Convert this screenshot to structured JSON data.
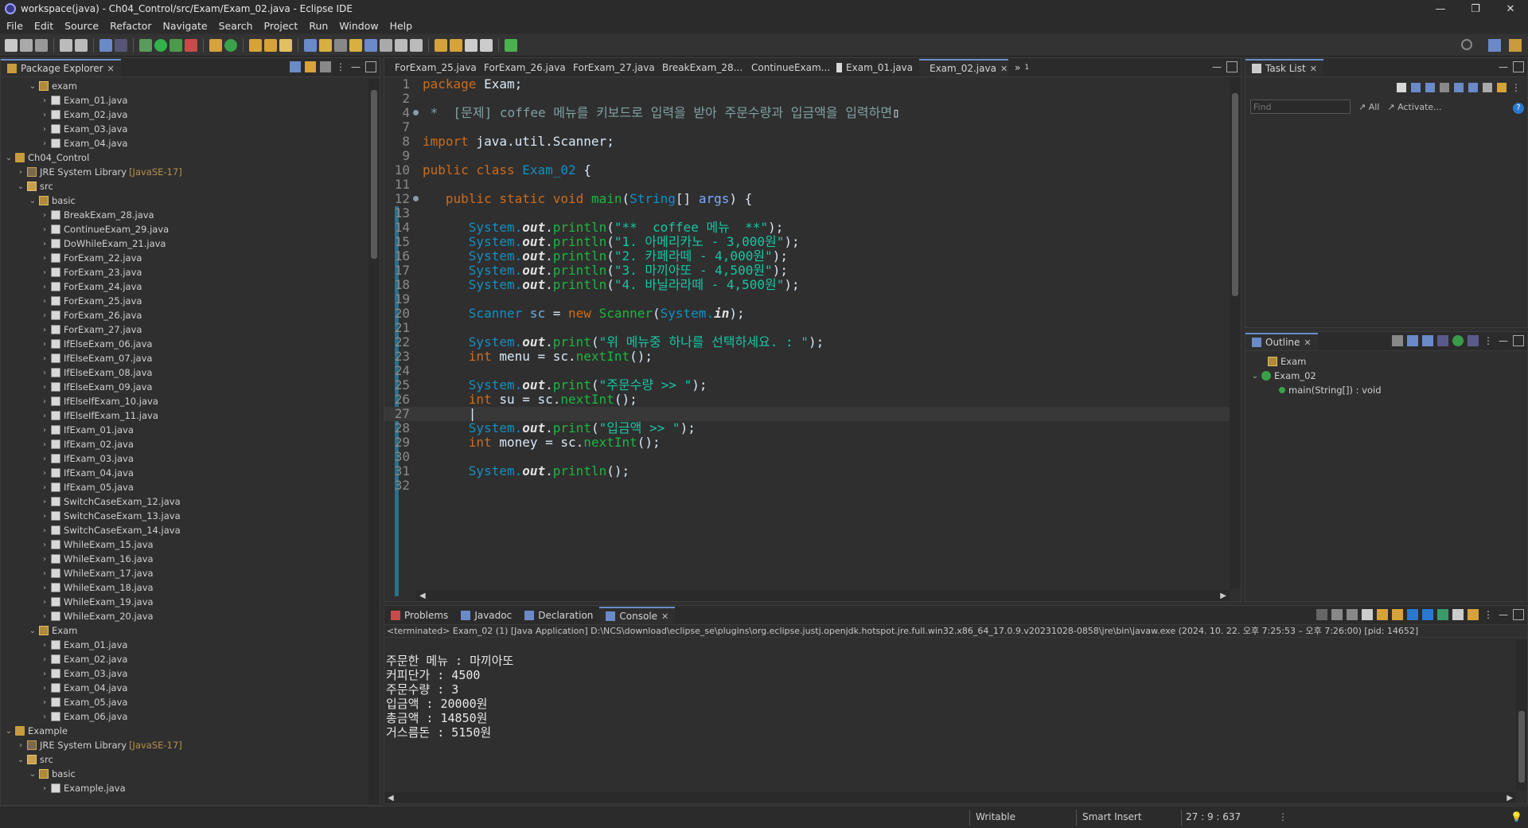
{
  "window": {
    "title": "workspace(java) - Ch04_Control/src/Exam/Exam_02.java - Eclipse IDE",
    "minimize": "—",
    "maximize": "❐",
    "close": "✕"
  },
  "menu": [
    "File",
    "Edit",
    "Source",
    "Refactor",
    "Navigate",
    "Search",
    "Project",
    "Run",
    "Window",
    "Help"
  ],
  "package_explorer": {
    "title": "Package Explorer",
    "rows": [
      {
        "indent": 2,
        "arrow": "⌄",
        "icon": "pkg",
        "label": "exam"
      },
      {
        "indent": 3,
        "arrow": "›",
        "icon": "file",
        "label": "Exam_01.java"
      },
      {
        "indent": 3,
        "arrow": "›",
        "icon": "file",
        "label": "Exam_02.java"
      },
      {
        "indent": 3,
        "arrow": "›",
        "icon": "file",
        "label": "Exam_03.java"
      },
      {
        "indent": 3,
        "arrow": "›",
        "icon": "file",
        "label": "Exam_04.java"
      },
      {
        "indent": 0,
        "arrow": "⌄",
        "icon": "proj",
        "label": "Ch04_Control"
      },
      {
        "indent": 1,
        "arrow": "›",
        "icon": "jre",
        "label": "JRE System Library",
        "extra": "[JavaSE-17]"
      },
      {
        "indent": 1,
        "arrow": "⌄",
        "icon": "src",
        "label": "src"
      },
      {
        "indent": 2,
        "arrow": "⌄",
        "icon": "pkg",
        "label": "basic"
      },
      {
        "indent": 3,
        "arrow": "›",
        "icon": "file",
        "label": "BreakExam_28.java"
      },
      {
        "indent": 3,
        "arrow": "›",
        "icon": "file",
        "label": "ContinueExam_29.java"
      },
      {
        "indent": 3,
        "arrow": "›",
        "icon": "file",
        "label": "DoWhileExam_21.java"
      },
      {
        "indent": 3,
        "arrow": "›",
        "icon": "file",
        "label": "ForExam_22.java"
      },
      {
        "indent": 3,
        "arrow": "›",
        "icon": "file",
        "label": "ForExam_23.java"
      },
      {
        "indent": 3,
        "arrow": "›",
        "icon": "file",
        "label": "ForExam_24.java"
      },
      {
        "indent": 3,
        "arrow": "›",
        "icon": "file",
        "label": "ForExam_25.java"
      },
      {
        "indent": 3,
        "arrow": "›",
        "icon": "file",
        "label": "ForExam_26.java"
      },
      {
        "indent": 3,
        "arrow": "›",
        "icon": "file",
        "label": "ForExam_27.java"
      },
      {
        "indent": 3,
        "arrow": "›",
        "icon": "file",
        "label": "IfElseExam_06.java"
      },
      {
        "indent": 3,
        "arrow": "›",
        "icon": "file",
        "label": "IfElseExam_07.java"
      },
      {
        "indent": 3,
        "arrow": "›",
        "icon": "file",
        "label": "IfElseExam_08.java"
      },
      {
        "indent": 3,
        "arrow": "›",
        "icon": "file",
        "label": "IfElseExam_09.java"
      },
      {
        "indent": 3,
        "arrow": "›",
        "icon": "file",
        "label": "IfElseIfExam_10.java"
      },
      {
        "indent": 3,
        "arrow": "›",
        "icon": "file",
        "label": "IfElseIfExam_11.java"
      },
      {
        "indent": 3,
        "arrow": "›",
        "icon": "file",
        "label": "IfExam_01.java"
      },
      {
        "indent": 3,
        "arrow": "›",
        "icon": "file",
        "label": "IfExam_02.java"
      },
      {
        "indent": 3,
        "arrow": "›",
        "icon": "file",
        "label": "IfExam_03.java"
      },
      {
        "indent": 3,
        "arrow": "›",
        "icon": "file",
        "label": "IfExam_04.java"
      },
      {
        "indent": 3,
        "arrow": "›",
        "icon": "file",
        "label": "IfExam_05.java"
      },
      {
        "indent": 3,
        "arrow": "›",
        "icon": "file",
        "label": "SwitchCaseExam_12.java"
      },
      {
        "indent": 3,
        "arrow": "›",
        "icon": "file",
        "label": "SwitchCaseExam_13.java"
      },
      {
        "indent": 3,
        "arrow": "›",
        "icon": "file",
        "label": "SwitchCaseExam_14.java"
      },
      {
        "indent": 3,
        "arrow": "›",
        "icon": "file",
        "label": "WhileExam_15.java"
      },
      {
        "indent": 3,
        "arrow": "›",
        "icon": "file",
        "label": "WhileExam_16.java"
      },
      {
        "indent": 3,
        "arrow": "›",
        "icon": "file",
        "label": "WhileExam_17.java"
      },
      {
        "indent": 3,
        "arrow": "›",
        "icon": "file",
        "label": "WhileExam_18.java"
      },
      {
        "indent": 3,
        "arrow": "›",
        "icon": "file",
        "label": "WhileExam_19.java"
      },
      {
        "indent": 3,
        "arrow": "›",
        "icon": "file",
        "label": "WhileExam_20.java"
      },
      {
        "indent": 2,
        "arrow": "⌄",
        "icon": "pkg",
        "label": "Exam"
      },
      {
        "indent": 3,
        "arrow": "›",
        "icon": "file",
        "label": "Exam_01.java"
      },
      {
        "indent": 3,
        "arrow": "›",
        "icon": "file",
        "label": "Exam_02.java"
      },
      {
        "indent": 3,
        "arrow": "›",
        "icon": "file",
        "label": "Exam_03.java"
      },
      {
        "indent": 3,
        "arrow": "›",
        "icon": "file",
        "label": "Exam_04.java"
      },
      {
        "indent": 3,
        "arrow": "›",
        "icon": "file",
        "label": "Exam_05.java"
      },
      {
        "indent": 3,
        "arrow": "›",
        "icon": "file",
        "label": "Exam_06.java"
      },
      {
        "indent": 0,
        "arrow": "⌄",
        "icon": "proj",
        "label": "Example"
      },
      {
        "indent": 1,
        "arrow": "›",
        "icon": "jre",
        "label": "JRE System Library",
        "extra": "[JavaSE-17]"
      },
      {
        "indent": 1,
        "arrow": "⌄",
        "icon": "src",
        "label": "src"
      },
      {
        "indent": 2,
        "arrow": "⌄",
        "icon": "pkg",
        "label": "basic"
      },
      {
        "indent": 3,
        "arrow": "›",
        "icon": "file",
        "label": "Example.java"
      }
    ]
  },
  "editor": {
    "tabs": [
      {
        "label": "ForExam_25.java",
        "active": false
      },
      {
        "label": "ForExam_26.java",
        "active": false
      },
      {
        "label": "ForExam_27.java",
        "active": false
      },
      {
        "label": "BreakExam_28...",
        "active": false
      },
      {
        "label": "ContinueExam...",
        "active": false
      },
      {
        "label": "Exam_01.java",
        "active": false
      },
      {
        "label": "Exam_02.java",
        "active": true
      }
    ],
    "overflow": "»",
    "overflow_count": "1",
    "current_line": 27,
    "lines": [
      {
        "n": "1",
        "mark": "",
        "tokens": [
          [
            "k",
            "package"
          ],
          [
            "pl",
            " Exam;"
          ]
        ]
      },
      {
        "n": "2",
        "mark": "",
        "tokens": []
      },
      {
        "n": "4",
        "mark": "fold",
        "tokens": [
          [
            "cm",
            " *  [문제] coffee 메뉴를 키보드로 입력을 받아 주문수량과 입금액을 입력하면"
          ],
          [
            "pl",
            "▯"
          ]
        ]
      },
      {
        "n": "7",
        "mark": "",
        "tokens": []
      },
      {
        "n": "8",
        "mark": "",
        "tokens": [
          [
            "k",
            "import"
          ],
          [
            "pl",
            " java.util.Scanner;"
          ]
        ]
      },
      {
        "n": "9",
        "mark": "",
        "tokens": []
      },
      {
        "n": "10",
        "mark": "",
        "tokens": [
          [
            "k",
            "public class "
          ],
          [
            "ty",
            "Exam_02"
          ],
          [
            "pl",
            " {"
          ]
        ]
      },
      {
        "n": "11",
        "mark": "",
        "tokens": []
      },
      {
        "n": "12",
        "mark": "fold",
        "tokens": [
          [
            "pl",
            "   "
          ],
          [
            "k",
            "public static void "
          ],
          [
            "fn",
            "main"
          ],
          [
            "pl",
            "("
          ],
          [
            "ty",
            "String"
          ],
          [
            "pl",
            "[] "
          ],
          [
            "va",
            "args"
          ],
          [
            "pl",
            ") {"
          ]
        ]
      },
      {
        "n": "13",
        "mark": "",
        "tokens": []
      },
      {
        "n": "14",
        "mark": "",
        "tokens": [
          [
            "pl",
            "      "
          ],
          [
            "ty",
            "System."
          ],
          [
            "it",
            "out"
          ],
          [
            "pl",
            "."
          ],
          [
            "fn",
            "println"
          ],
          [
            "pl",
            "("
          ],
          [
            "st",
            "\"**  coffee 메뉴  **\""
          ],
          [
            "pl",
            ");"
          ]
        ]
      },
      {
        "n": "15",
        "mark": "",
        "tokens": [
          [
            "pl",
            "      "
          ],
          [
            "ty",
            "System."
          ],
          [
            "it",
            "out"
          ],
          [
            "pl",
            "."
          ],
          [
            "fn",
            "println"
          ],
          [
            "pl",
            "("
          ],
          [
            "st",
            "\"1. 아메리카노 - 3,000원\""
          ],
          [
            "pl",
            ");"
          ]
        ]
      },
      {
        "n": "16",
        "mark": "",
        "tokens": [
          [
            "pl",
            "      "
          ],
          [
            "ty",
            "System."
          ],
          [
            "it",
            "out"
          ],
          [
            "pl",
            "."
          ],
          [
            "fn",
            "println"
          ],
          [
            "pl",
            "("
          ],
          [
            "st",
            "\"2. 카페라떼 - 4,000원\""
          ],
          [
            "pl",
            ");"
          ]
        ]
      },
      {
        "n": "17",
        "mark": "",
        "tokens": [
          [
            "pl",
            "      "
          ],
          [
            "ty",
            "System."
          ],
          [
            "it",
            "out"
          ],
          [
            "pl",
            "."
          ],
          [
            "fn",
            "println"
          ],
          [
            "pl",
            "("
          ],
          [
            "st",
            "\"3. 마끼아또 - 4,500원\""
          ],
          [
            "pl",
            ");"
          ]
        ]
      },
      {
        "n": "18",
        "mark": "",
        "tokens": [
          [
            "pl",
            "      "
          ],
          [
            "ty",
            "System."
          ],
          [
            "it",
            "out"
          ],
          [
            "pl",
            "."
          ],
          [
            "fn",
            "println"
          ],
          [
            "pl",
            "("
          ],
          [
            "st",
            "\"4. 바닐라라떼 - 4,500원\""
          ],
          [
            "pl",
            ");"
          ]
        ]
      },
      {
        "n": "19",
        "mark": "",
        "tokens": []
      },
      {
        "n": "20",
        "mark": "",
        "tokens": [
          [
            "pl",
            "      "
          ],
          [
            "ty",
            "Scanner "
          ],
          [
            "ins",
            "sc"
          ],
          [
            "pl",
            " = "
          ],
          [
            "k",
            "new "
          ],
          [
            "fn",
            "Scanner"
          ],
          [
            "pl",
            "("
          ],
          [
            "ty",
            "System."
          ],
          [
            "it",
            "in"
          ],
          [
            "pl",
            ");"
          ]
        ]
      },
      {
        "n": "21",
        "mark": "",
        "tokens": []
      },
      {
        "n": "22",
        "mark": "",
        "tokens": [
          [
            "pl",
            "      "
          ],
          [
            "ty",
            "System."
          ],
          [
            "it",
            "out"
          ],
          [
            "pl",
            "."
          ],
          [
            "fn",
            "print"
          ],
          [
            "pl",
            "("
          ],
          [
            "st",
            "\"위 메뉴중 하나를 선택하세요. : \""
          ],
          [
            "pl",
            ");"
          ]
        ]
      },
      {
        "n": "23",
        "mark": "",
        "tokens": [
          [
            "pl",
            "      "
          ],
          [
            "k",
            "int "
          ],
          [
            "pl",
            "menu = sc."
          ],
          [
            "fn",
            "nextInt"
          ],
          [
            "pl",
            "();"
          ]
        ]
      },
      {
        "n": "24",
        "mark": "",
        "tokens": []
      },
      {
        "n": "25",
        "mark": "",
        "tokens": [
          [
            "pl",
            "      "
          ],
          [
            "ty",
            "System."
          ],
          [
            "it",
            "out"
          ],
          [
            "pl",
            "."
          ],
          [
            "fn",
            "print"
          ],
          [
            "pl",
            "("
          ],
          [
            "st",
            "\"주문수량 >> \""
          ],
          [
            "pl",
            ");"
          ]
        ]
      },
      {
        "n": "26",
        "mark": "",
        "tokens": [
          [
            "pl",
            "      "
          ],
          [
            "k",
            "int "
          ],
          [
            "pl",
            "su = sc."
          ],
          [
            "fn",
            "nextInt"
          ],
          [
            "pl",
            "();"
          ]
        ]
      },
      {
        "n": "27",
        "mark": "",
        "tokens": [
          [
            "pl",
            "      |"
          ]
        ]
      },
      {
        "n": "28",
        "mark": "",
        "tokens": [
          [
            "pl",
            "      "
          ],
          [
            "ty",
            "System."
          ],
          [
            "it",
            "out"
          ],
          [
            "pl",
            "."
          ],
          [
            "fn",
            "print"
          ],
          [
            "pl",
            "("
          ],
          [
            "st",
            "\"입금액 >> \""
          ],
          [
            "pl",
            ");"
          ]
        ]
      },
      {
        "n": "29",
        "mark": "",
        "tokens": [
          [
            "pl",
            "      "
          ],
          [
            "k",
            "int "
          ],
          [
            "pl",
            "money = sc."
          ],
          [
            "fn",
            "nextInt"
          ],
          [
            "pl",
            "();"
          ]
        ]
      },
      {
        "n": "30",
        "mark": "",
        "tokens": []
      },
      {
        "n": "31",
        "mark": "",
        "tokens": [
          [
            "pl",
            "      "
          ],
          [
            "ty",
            "System."
          ],
          [
            "it",
            "out"
          ],
          [
            "pl",
            "."
          ],
          [
            "fn",
            "println"
          ],
          [
            "pl",
            "();"
          ]
        ]
      },
      {
        "n": "32",
        "mark": "",
        "tokens": []
      }
    ]
  },
  "task_list": {
    "title": "Task List",
    "find_placeholder": "Find",
    "all_label": "All",
    "activate_label": "Activate..."
  },
  "outline": {
    "title": "Outline",
    "items": [
      {
        "label": "Exam",
        "level": 0,
        "icon": "pkg"
      },
      {
        "label": "Exam_02",
        "level": 0,
        "icon": "class",
        "expanded": true
      },
      {
        "label": "main(String[]) : void",
        "level": 1,
        "icon": "method"
      }
    ]
  },
  "bottom": {
    "tabs": [
      {
        "label": "Problems",
        "active": false
      },
      {
        "label": "Javadoc",
        "active": false
      },
      {
        "label": "Declaration",
        "active": false
      },
      {
        "label": "Console",
        "active": true
      }
    ],
    "console_header": "<terminated> Exam_02 (1) [Java Application] D:\\NCS\\download\\eclipse_se\\plugins\\org.eclipse.justj.openjdk.hotspot.jre.full.win32.x86_64_17.0.9.v20231028-0858\\jre\\bin\\javaw.exe  (2024. 10. 22. 오후 7:25:53 – 오후 7:26:00) [pid: 14652]",
    "console_lines": [
      "",
      "주문한 메뉴 : 마끼아또",
      "커피단가 : 4500",
      "주문수량 : 3",
      "입금액 : 20000원",
      "총금액 : 14850원",
      "거스름돈 : 5150원"
    ]
  },
  "status": {
    "writable": "Writable",
    "insert": "Smart Insert",
    "position": "27 : 9 : 637"
  }
}
